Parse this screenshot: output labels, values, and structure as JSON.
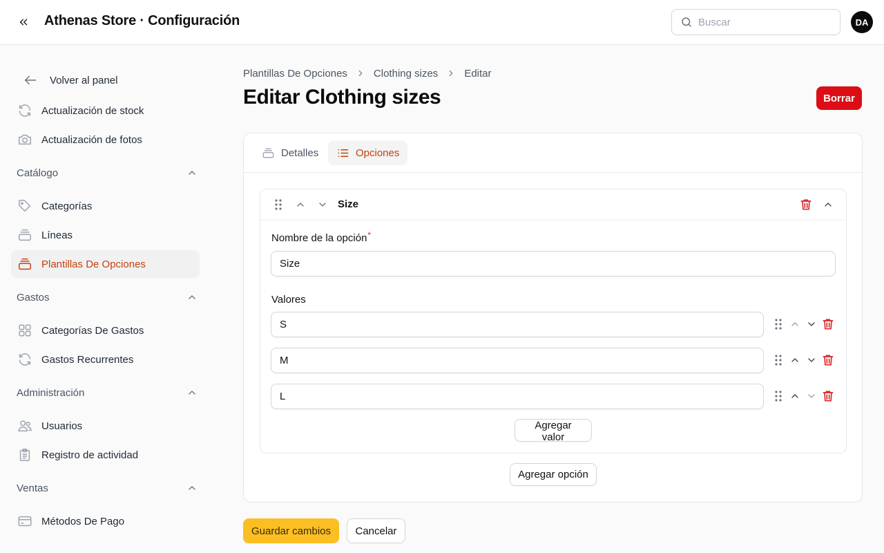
{
  "header": {
    "title": "Athenas Store · Configuración",
    "search_placeholder": "Buscar",
    "avatar_initials": "DA"
  },
  "sidebar": {
    "back_label": "Volver al panel",
    "top_items": [
      {
        "label": "Actualización de stock",
        "icon": "refresh-icon"
      },
      {
        "label": "Actualización de fotos",
        "icon": "camera-icon"
      }
    ],
    "groups": [
      {
        "label": "Catálogo",
        "items": [
          {
            "label": "Categorías",
            "icon": "tag-icon"
          },
          {
            "label": "Líneas",
            "icon": "stack-icon"
          },
          {
            "label": "Plantillas De Opciones",
            "icon": "stack-icon",
            "active": true
          }
        ]
      },
      {
        "label": "Gastos",
        "items": [
          {
            "label": "Categorías De Gastos",
            "icon": "grid-icon"
          },
          {
            "label": "Gastos Recurrentes",
            "icon": "refresh-icon"
          }
        ]
      },
      {
        "label": "Administración",
        "items": [
          {
            "label": "Usuarios",
            "icon": "users-icon"
          },
          {
            "label": "Registro de actividad",
            "icon": "clipboard-icon"
          }
        ]
      },
      {
        "label": "Ventas",
        "items": [
          {
            "label": "Métodos De Pago",
            "icon": "credit-card-icon"
          }
        ]
      }
    ]
  },
  "breadcrumb": [
    "Plantillas De Opciones",
    "Clothing sizes",
    "Editar"
  ],
  "page": {
    "title": "Editar Clothing sizes",
    "delete_label": "Borrar"
  },
  "tabs": [
    {
      "label": "Detalles",
      "icon": "stack-icon",
      "active": false
    },
    {
      "label": "Opciones",
      "icon": "list-icon",
      "active": true
    }
  ],
  "option": {
    "header_name": "Size",
    "name_label": "Nombre de la opción",
    "required_mark": "*",
    "name_value": "Size",
    "values_label": "Valores",
    "values": [
      "S",
      "M",
      "L"
    ],
    "add_value_label": "Agregar valor"
  },
  "add_option_label": "Agregar opción",
  "form": {
    "save_label": "Guardar cambios",
    "cancel_label": "Cancelar"
  },
  "colors": {
    "accent": "#c2410c",
    "primary_button": "#fbbf24",
    "danger": "#dc0d15"
  }
}
